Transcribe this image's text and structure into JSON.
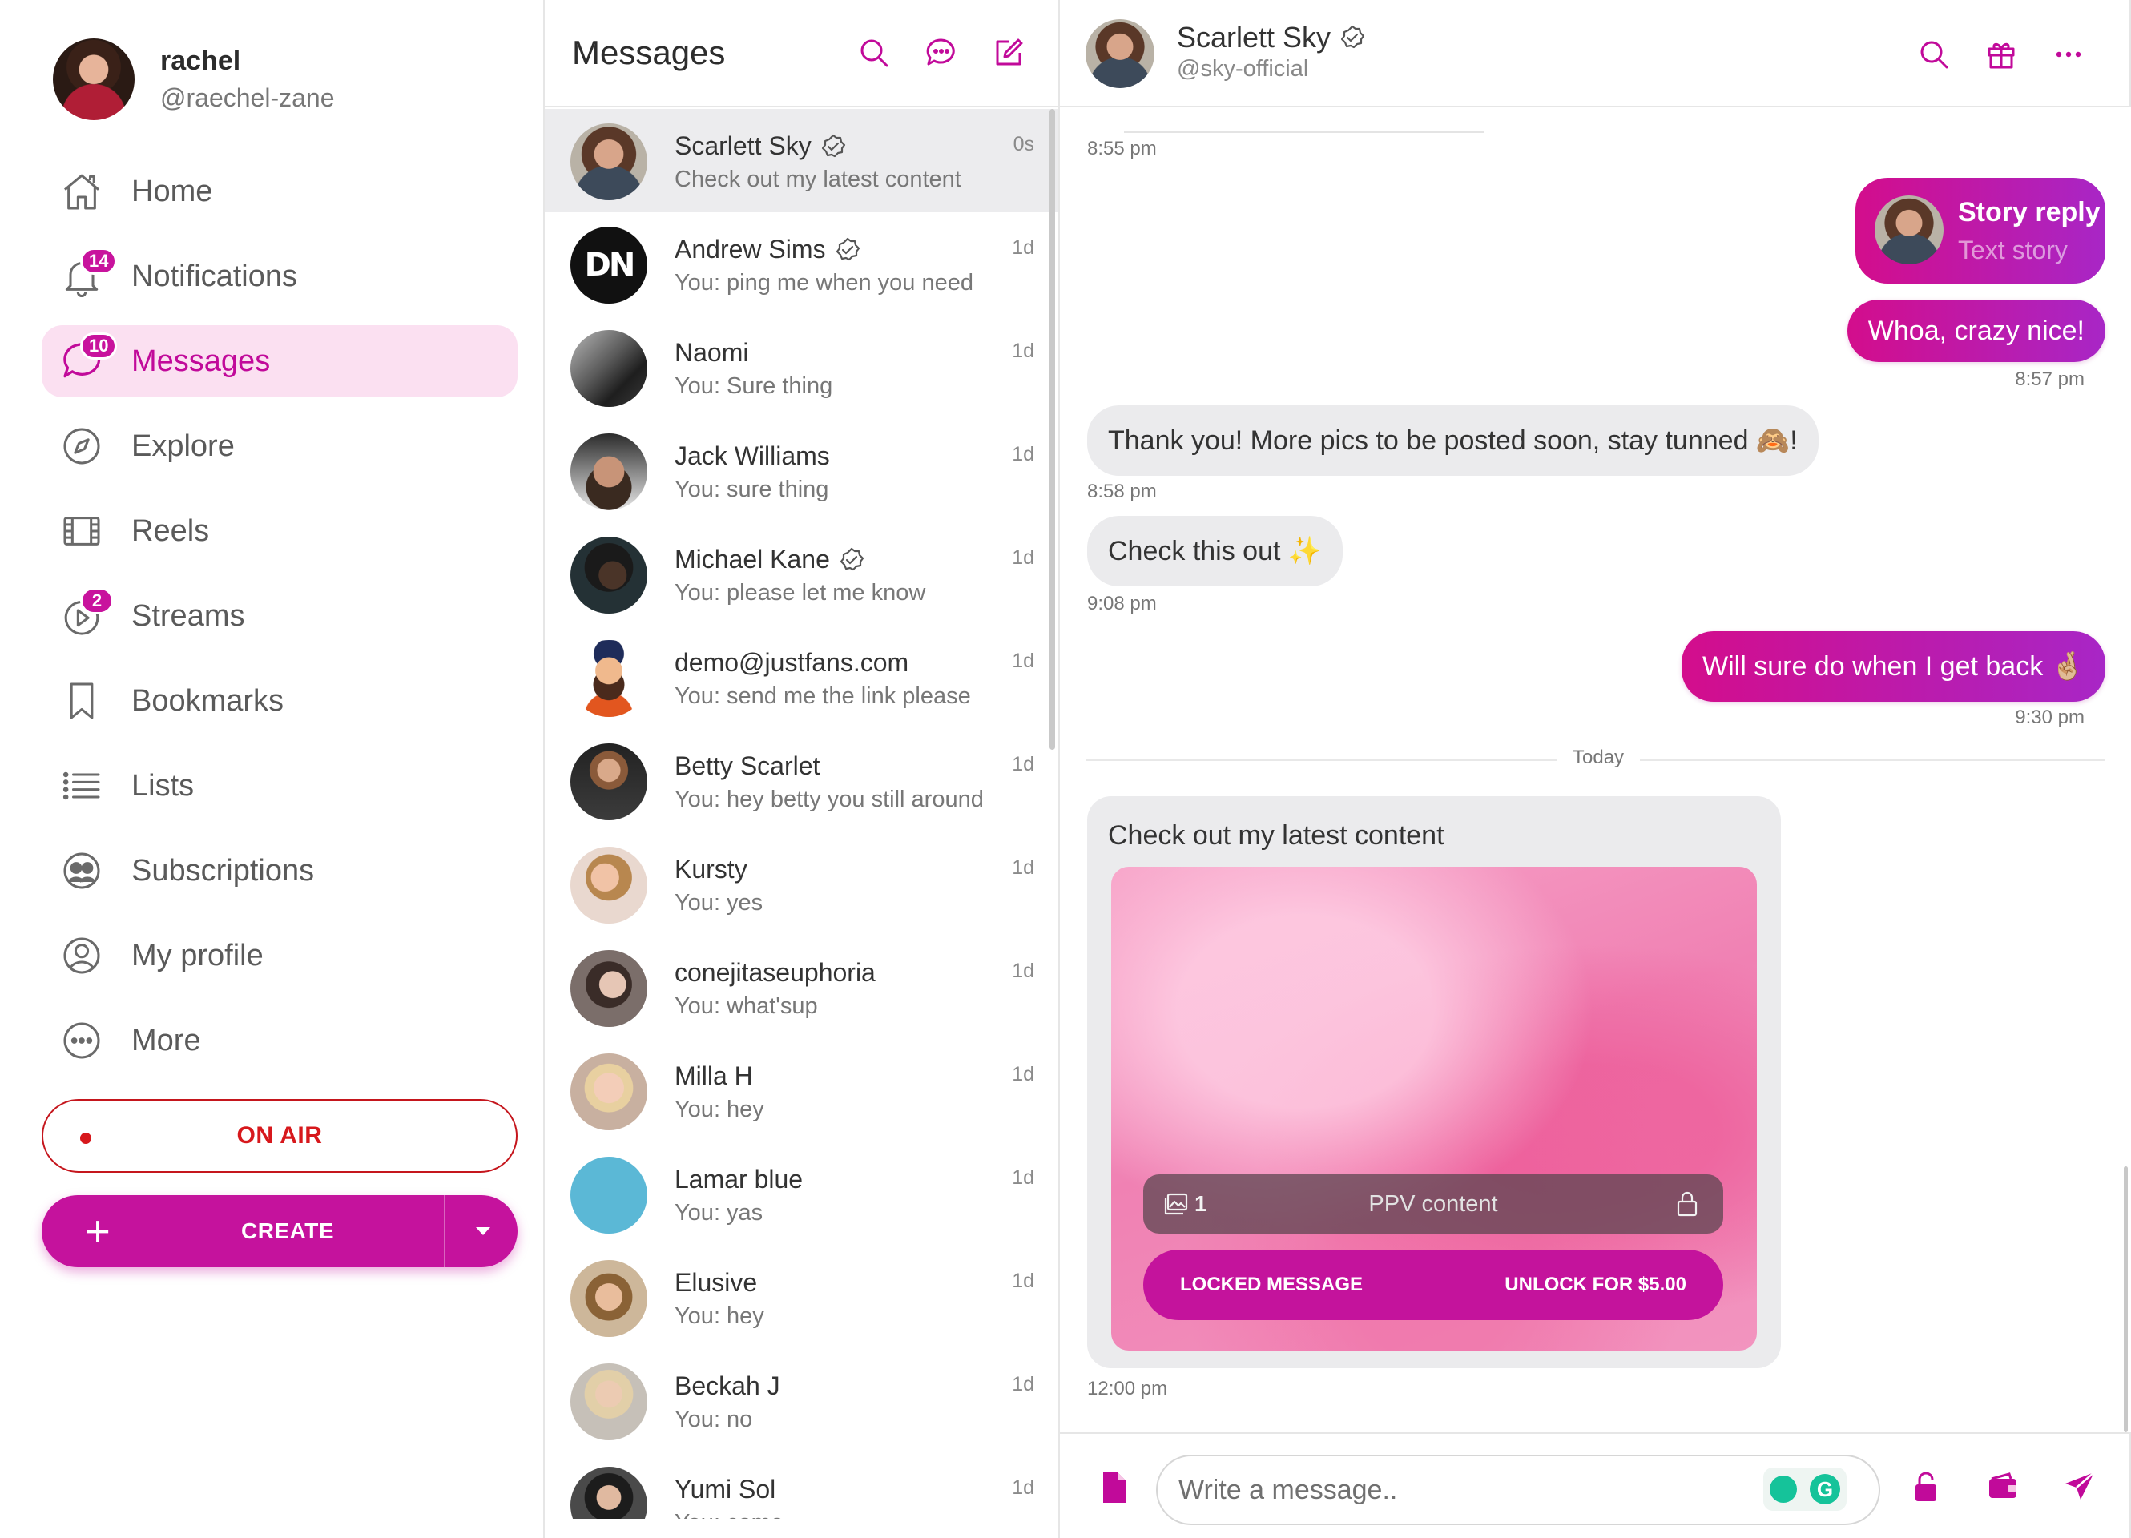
{
  "colors": {
    "accent": "#c5129d",
    "accent_light": "#fbe0f1",
    "onair": "#d7181c",
    "gradient_start": "#d30d8c",
    "gradient_end": "#a826c6"
  },
  "user": {
    "name": "rachel",
    "handle": "@raechel-zane"
  },
  "nav": [
    {
      "label": "Home",
      "icon": "home-icon"
    },
    {
      "label": "Notifications",
      "icon": "bell-icon",
      "badge": "14"
    },
    {
      "label": "Messages",
      "icon": "chat-bubble-icon",
      "badge": "10",
      "active": true
    },
    {
      "label": "Explore",
      "icon": "compass-icon"
    },
    {
      "label": "Reels",
      "icon": "film-icon"
    },
    {
      "label": "Streams",
      "icon": "play-circle-icon",
      "badge": "2"
    },
    {
      "label": "Bookmarks",
      "icon": "bookmark-icon"
    },
    {
      "label": "Lists",
      "icon": "list-icon"
    },
    {
      "label": "Subscriptions",
      "icon": "users-icon"
    },
    {
      "label": "My profile",
      "icon": "user-circle-icon"
    },
    {
      "label": "More",
      "icon": "more-circle-icon"
    }
  ],
  "onair_label": "ON AIR",
  "create_label": "CREATE",
  "messages_pane": {
    "title": "Messages",
    "icons": [
      "search-icon",
      "chat-dots-icon",
      "compose-icon"
    ],
    "conversations": [
      {
        "name": "Scarlett Sky",
        "verified": true,
        "preview": "Check out my latest content",
        "time": "0s",
        "active": true,
        "avatar": "photo-a"
      },
      {
        "name": "Andrew Sims",
        "verified": true,
        "preview": "You: ping me when you need",
        "time": "1d",
        "avatar": "logo-dn"
      },
      {
        "name": "Naomi",
        "verified": false,
        "preview": "You: Sure thing",
        "time": "1d",
        "avatar": "photo-dark"
      },
      {
        "name": "Jack Williams",
        "verified": false,
        "preview": "You: sure thing",
        "time": "1d",
        "avatar": "photo-b"
      },
      {
        "name": "Michael Kane",
        "verified": true,
        "preview": "You: please let me know",
        "time": "1d",
        "avatar": "photo-c"
      },
      {
        "name": "demo@justfans.com",
        "verified": false,
        "preview": "You: send me the link please",
        "time": "1d",
        "avatar": "cartoon"
      },
      {
        "name": "Betty Scarlet",
        "verified": false,
        "preview": "You: hey betty you still around",
        "time": "1d",
        "avatar": "photo-d"
      },
      {
        "name": "Kursty",
        "verified": false,
        "preview": "You: yes",
        "time": "1d",
        "avatar": "photo-e"
      },
      {
        "name": "conejitaseuphoria",
        "verified": false,
        "preview": "You: what'sup",
        "time": "1d",
        "avatar": "photo-f"
      },
      {
        "name": "Milla H",
        "verified": false,
        "preview": "You: hey",
        "time": "1d",
        "avatar": "photo-g"
      },
      {
        "name": "Lamar blue",
        "verified": false,
        "preview": "You: yas",
        "time": "1d",
        "avatar": "plain-blue"
      },
      {
        "name": "Elusive",
        "verified": false,
        "preview": "You: hey",
        "time": "1d",
        "avatar": "photo-h"
      },
      {
        "name": "Beckah J",
        "verified": false,
        "preview": "You: no",
        "time": "1d",
        "avatar": "photo-i"
      },
      {
        "name": "Yumi Sol",
        "verified": false,
        "preview": "You: come",
        "time": "1d",
        "avatar": "photo-j"
      }
    ]
  },
  "chat": {
    "contact_name": "Scarlett Sky",
    "contact_handle": "@sky-official",
    "header_icons": [
      "search-icon",
      "gift-icon",
      "more-dots-icon"
    ],
    "messages": {
      "t1": "8:55 pm",
      "story_title": "Story reply",
      "story_sub": "Text story",
      "out1": "Whoa, crazy nice!",
      "t2": "8:57 pm",
      "in1": "Thank you! More pics to be posted soon, stay tunned 🙈!",
      "t3": "8:58 pm",
      "in2": "Check this out ✨",
      "t4": "9:08 pm",
      "out2": "Will sure do when I get back 🤞🏼",
      "t5": "9:30 pm",
      "divider": "Today",
      "ppv_caption": "Check out my latest content",
      "ppv_count": "1",
      "ppv_label": "PPV content",
      "locked_label": "LOCKED MESSAGE",
      "unlock_label": "UNLOCK FOR $5.00",
      "t6": "12:00 pm"
    },
    "composer": {
      "placeholder": "Write a message..",
      "icons": [
        "file-icon",
        "lock-icon",
        "wallet-icon",
        "send-icon"
      ]
    }
  }
}
